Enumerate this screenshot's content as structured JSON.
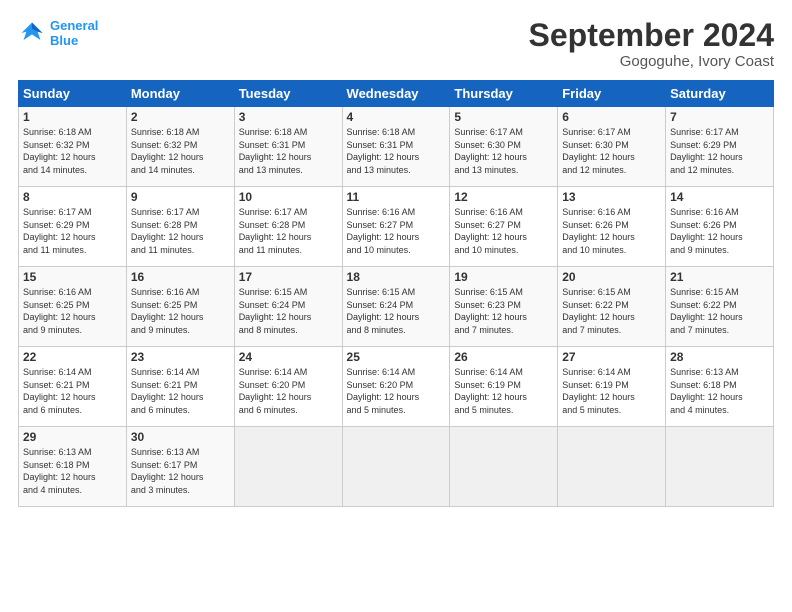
{
  "header": {
    "logo_line1": "General",
    "logo_line2": "Blue",
    "month": "September 2024",
    "location": "Gogoguhe, Ivory Coast"
  },
  "days_of_week": [
    "Sunday",
    "Monday",
    "Tuesday",
    "Wednesday",
    "Thursday",
    "Friday",
    "Saturday"
  ],
  "weeks": [
    [
      {
        "day": "1",
        "sunrise": "6:18 AM",
        "sunset": "6:32 PM",
        "daylight": "12 hours and 14 minutes."
      },
      {
        "day": "2",
        "sunrise": "6:18 AM",
        "sunset": "6:32 PM",
        "daylight": "12 hours and 14 minutes."
      },
      {
        "day": "3",
        "sunrise": "6:18 AM",
        "sunset": "6:31 PM",
        "daylight": "12 hours and 13 minutes."
      },
      {
        "day": "4",
        "sunrise": "6:18 AM",
        "sunset": "6:31 PM",
        "daylight": "12 hours and 13 minutes."
      },
      {
        "day": "5",
        "sunrise": "6:17 AM",
        "sunset": "6:30 PM",
        "daylight": "12 hours and 13 minutes."
      },
      {
        "day": "6",
        "sunrise": "6:17 AM",
        "sunset": "6:30 PM",
        "daylight": "12 hours and 12 minutes."
      },
      {
        "day": "7",
        "sunrise": "6:17 AM",
        "sunset": "6:29 PM",
        "daylight": "12 hours and 12 minutes."
      }
    ],
    [
      {
        "day": "8",
        "sunrise": "6:17 AM",
        "sunset": "6:29 PM",
        "daylight": "12 hours and 11 minutes."
      },
      {
        "day": "9",
        "sunrise": "6:17 AM",
        "sunset": "6:28 PM",
        "daylight": "12 hours and 11 minutes."
      },
      {
        "day": "10",
        "sunrise": "6:17 AM",
        "sunset": "6:28 PM",
        "daylight": "12 hours and 11 minutes."
      },
      {
        "day": "11",
        "sunrise": "6:16 AM",
        "sunset": "6:27 PM",
        "daylight": "12 hours and 10 minutes."
      },
      {
        "day": "12",
        "sunrise": "6:16 AM",
        "sunset": "6:27 PM",
        "daylight": "12 hours and 10 minutes."
      },
      {
        "day": "13",
        "sunrise": "6:16 AM",
        "sunset": "6:26 PM",
        "daylight": "12 hours and 10 minutes."
      },
      {
        "day": "14",
        "sunrise": "6:16 AM",
        "sunset": "6:26 PM",
        "daylight": "12 hours and 9 minutes."
      }
    ],
    [
      {
        "day": "15",
        "sunrise": "6:16 AM",
        "sunset": "6:25 PM",
        "daylight": "12 hours and 9 minutes."
      },
      {
        "day": "16",
        "sunrise": "6:16 AM",
        "sunset": "6:25 PM",
        "daylight": "12 hours and 9 minutes."
      },
      {
        "day": "17",
        "sunrise": "6:15 AM",
        "sunset": "6:24 PM",
        "daylight": "12 hours and 8 minutes."
      },
      {
        "day": "18",
        "sunrise": "6:15 AM",
        "sunset": "6:24 PM",
        "daylight": "12 hours and 8 minutes."
      },
      {
        "day": "19",
        "sunrise": "6:15 AM",
        "sunset": "6:23 PM",
        "daylight": "12 hours and 7 minutes."
      },
      {
        "day": "20",
        "sunrise": "6:15 AM",
        "sunset": "6:22 PM",
        "daylight": "12 hours and 7 minutes."
      },
      {
        "day": "21",
        "sunrise": "6:15 AM",
        "sunset": "6:22 PM",
        "daylight": "12 hours and 7 minutes."
      }
    ],
    [
      {
        "day": "22",
        "sunrise": "6:14 AM",
        "sunset": "6:21 PM",
        "daylight": "12 hours and 6 minutes."
      },
      {
        "day": "23",
        "sunrise": "6:14 AM",
        "sunset": "6:21 PM",
        "daylight": "12 hours and 6 minutes."
      },
      {
        "day": "24",
        "sunrise": "6:14 AM",
        "sunset": "6:20 PM",
        "daylight": "12 hours and 6 minutes."
      },
      {
        "day": "25",
        "sunrise": "6:14 AM",
        "sunset": "6:20 PM",
        "daylight": "12 hours and 5 minutes."
      },
      {
        "day": "26",
        "sunrise": "6:14 AM",
        "sunset": "6:19 PM",
        "daylight": "12 hours and 5 minutes."
      },
      {
        "day": "27",
        "sunrise": "6:14 AM",
        "sunset": "6:19 PM",
        "daylight": "12 hours and 5 minutes."
      },
      {
        "day": "28",
        "sunrise": "6:13 AM",
        "sunset": "6:18 PM",
        "daylight": "12 hours and 4 minutes."
      }
    ],
    [
      {
        "day": "29",
        "sunrise": "6:13 AM",
        "sunset": "6:18 PM",
        "daylight": "12 hours and 4 minutes."
      },
      {
        "day": "30",
        "sunrise": "6:13 AM",
        "sunset": "6:17 PM",
        "daylight": "12 hours and 3 minutes."
      },
      null,
      null,
      null,
      null,
      null
    ]
  ],
  "labels": {
    "sunrise": "Sunrise:",
    "sunset": "Sunset:",
    "daylight": "Daylight:"
  }
}
